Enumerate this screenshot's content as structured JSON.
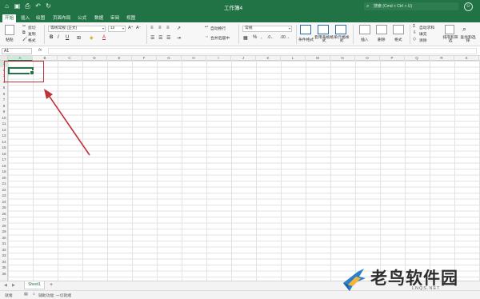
{
  "titlebar": {
    "title": "工作簿4",
    "search_placeholder": "搜索 (Cmd + Ctrl + U)",
    "qa_icons": [
      "home-icon",
      "save-icon",
      "print-icon",
      "undo-icon",
      "redo-icon"
    ]
  },
  "tabs": [
    "开始",
    "插入",
    "绘图",
    "页面布局",
    "公式",
    "数据",
    "审阅",
    "视图"
  ],
  "active_tab": "开始",
  "ribbon": {
    "paste": "粘贴",
    "cut": "剪切",
    "copy": "复制",
    "format_painter": "格式",
    "font_name": "等线常规 (正文)",
    "font_size": "12",
    "bold": "B",
    "italic": "I",
    "underline": "U",
    "wrap_text": "自动换行",
    "merge_center": "合并后居中",
    "number_format": "常规",
    "conditional_format": "条件格式",
    "format_as_table": "套用表格格式",
    "cell_styles": "单元格样式",
    "insert": "插入",
    "delete": "删除",
    "format": "格式",
    "autosum": "自动求和",
    "fill": "填充",
    "clear": "清除",
    "sort_filter": "排序和筛选",
    "find_select": "查找和选择"
  },
  "formula_bar": {
    "name_box": "A1",
    "fx": "fx",
    "value": ""
  },
  "grid": {
    "columns": [
      "A",
      "B",
      "C",
      "D",
      "E",
      "F",
      "G",
      "H",
      "I",
      "J",
      "K",
      "L",
      "M",
      "N",
      "O",
      "P",
      "Q",
      "R",
      "S"
    ],
    "rows": [
      "1",
      "2",
      "3",
      "4",
      "5",
      "6",
      "7",
      "8",
      "9",
      "10",
      "11",
      "12",
      "13",
      "14",
      "15",
      "16",
      "17",
      "18",
      "19",
      "20",
      "21",
      "22",
      "23",
      "24",
      "25",
      "26",
      "27",
      "28",
      "29",
      "30",
      "31",
      "32",
      "33",
      "34",
      "35",
      "36"
    ],
    "selected_column": "A",
    "selected_row": "1"
  },
  "sheets": {
    "tabs": [
      "Sheet1"
    ],
    "active": "Sheet1",
    "add_label": "+"
  },
  "statusbar": {
    "ready": "就绪",
    "accessibility": "辅助功能: 一切就绪"
  },
  "colors": {
    "brand_green": "#217346",
    "callout_red": "#c0323a"
  },
  "watermark": {
    "text": "老鸟软件园",
    "sub": "LNQS.NET"
  }
}
